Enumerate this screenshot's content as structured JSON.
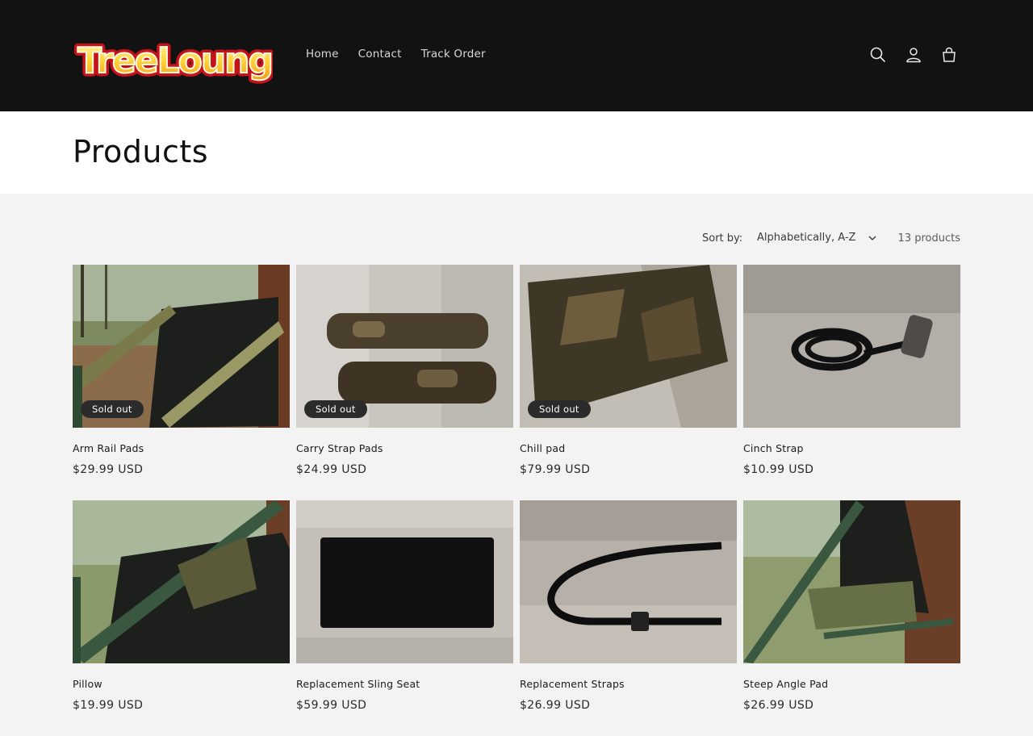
{
  "header": {
    "logo_text": "TreeLounge",
    "nav": [
      "Home",
      "Contact",
      "Track Order"
    ],
    "icons": [
      "search-icon",
      "account-icon",
      "cart-icon"
    ]
  },
  "page": {
    "title": "Products"
  },
  "toolbar": {
    "sort_label": "Sort by:",
    "sort_value": "Alphabetically, A-Z",
    "count": "13 products"
  },
  "products": [
    {
      "name": "Arm Rail Pads",
      "price": "$29.99 USD",
      "badge": "Sold out"
    },
    {
      "name": "Carry Strap Pads",
      "price": "$24.99 USD",
      "badge": "Sold out"
    },
    {
      "name": "Chill pad",
      "price": "$79.99 USD",
      "badge": "Sold out"
    },
    {
      "name": "Cinch Strap",
      "price": "$10.99 USD",
      "badge": ""
    },
    {
      "name": "Pillow",
      "price": "$19.99 USD",
      "badge": ""
    },
    {
      "name": "Replacement Sling Seat",
      "price": "$59.99 USD",
      "badge": ""
    },
    {
      "name": "Replacement Straps",
      "price": "$26.99 USD",
      "badge": ""
    },
    {
      "name": "Steep Angle Pad",
      "price": "$26.99 USD",
      "badge": ""
    }
  ],
  "colors": {
    "header_bg": "#121212",
    "page_bg": "#f3f3f3",
    "badge_bg": "#2b2b2b"
  }
}
